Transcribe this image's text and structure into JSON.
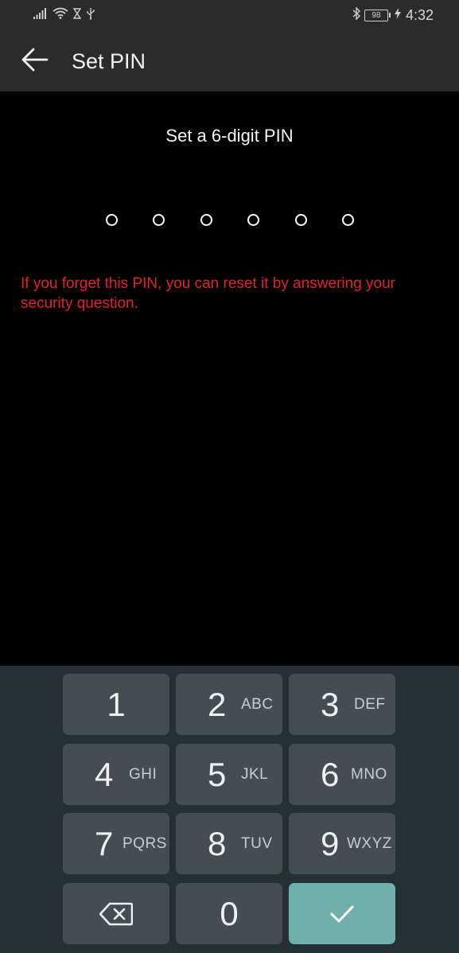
{
  "status_bar": {
    "time": "4:32",
    "battery": "98",
    "icons": [
      "signal-icon",
      "wifi-icon",
      "hourglass-icon",
      "usb-icon",
      "bluetooth-icon",
      "battery-icon",
      "charging-icon"
    ]
  },
  "app_bar": {
    "title": "Set PIN",
    "back_icon": "back-arrow-icon"
  },
  "main": {
    "heading": "Set a 6-digit PIN",
    "pin_length": 6,
    "pin_entered": 0,
    "hint": "If you forget this PIN, you can reset it by answering your security question."
  },
  "keypad": {
    "keys": [
      {
        "digit": "1",
        "letters": ""
      },
      {
        "digit": "2",
        "letters": "ABC"
      },
      {
        "digit": "3",
        "letters": "DEF"
      },
      {
        "digit": "4",
        "letters": "GHI"
      },
      {
        "digit": "5",
        "letters": "JKL"
      },
      {
        "digit": "6",
        "letters": "MNO"
      },
      {
        "digit": "7",
        "letters": "PQRS"
      },
      {
        "digit": "8",
        "letters": "TUV"
      },
      {
        "digit": "9",
        "letters": "WXYZ"
      }
    ],
    "zero": "0",
    "backspace_icon": "backspace-icon",
    "confirm_icon": "check-icon"
  },
  "colors": {
    "hint": "#e2222a",
    "confirm": "#6fb0aa",
    "keypad_bg": "#262f34",
    "key_bg": "#454d52",
    "app_bar_bg": "#2b2b2b"
  }
}
